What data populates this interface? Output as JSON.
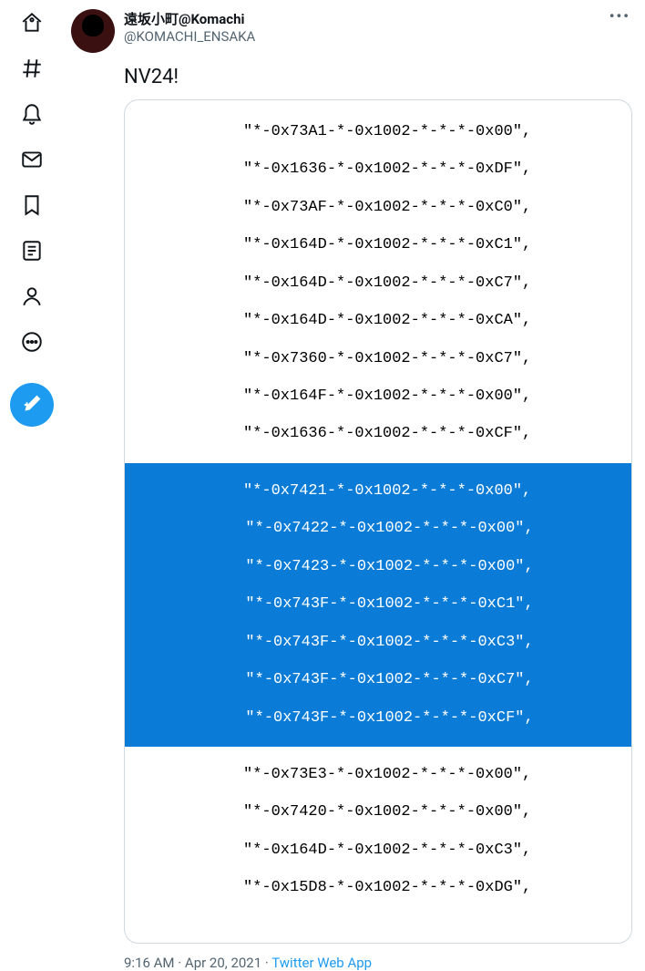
{
  "user": {
    "display_name": "遠坂小町@Komachi",
    "handle": "@KOMACHI_ENSAKA"
  },
  "tweet": {
    "text": "NV24!",
    "time": "9:16 AM",
    "date": "Apr 20, 2021",
    "source": "Twitter Web App",
    "sep1": " · ",
    "sep2": " · "
  },
  "code": {
    "before": [
      "\"*-0x73A1-*-0x1002-*-*-*-0x00\",",
      "\"*-0x1636-*-0x1002-*-*-*-0xDF\",",
      "\"*-0x73AF-*-0x1002-*-*-*-0xC0\",",
      "\"*-0x164D-*-0x1002-*-*-*-0xC1\",",
      "\"*-0x164D-*-0x1002-*-*-*-0xC7\",",
      "\"*-0x164D-*-0x1002-*-*-*-0xCA\",",
      "\"*-0x7360-*-0x1002-*-*-*-0xC7\",",
      "\"*-0x164F-*-0x1002-*-*-*-0x00\",",
      "\"*-0x1636-*-0x1002-*-*-*-0xCF\","
    ],
    "highlight": [
      "\"*-0x7421-*-0x1002-*-*-*-0x00\",",
      "\"*-0x7422-*-0x1002-*-*-*-0x00\",",
      "\"*-0x7423-*-0x1002-*-*-*-0x00\",",
      "\"*-0x743F-*-0x1002-*-*-*-0xC1\",",
      "\"*-0x743F-*-0x1002-*-*-*-0xC3\",",
      "\"*-0x743F-*-0x1002-*-*-*-0xC7\",",
      "\"*-0x743F-*-0x1002-*-*-*-0xCF\","
    ],
    "after": [
      "\"*-0x73E3-*-0x1002-*-*-*-0x00\",",
      "\"*-0x7420-*-0x1002-*-*-*-0x00\",",
      "\"*-0x164D-*-0x1002-*-*-*-0xC3\",",
      "\"*-0x15D8-*-0x1002-*-*-*-0xDG\","
    ]
  },
  "more": "•••"
}
